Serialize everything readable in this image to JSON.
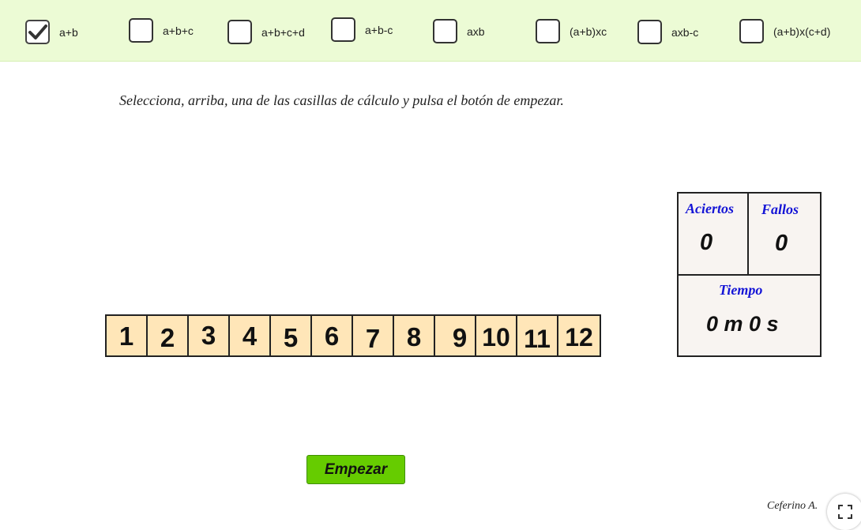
{
  "options": [
    {
      "label": "a+b",
      "checked": true
    },
    {
      "label": "a+b+c",
      "checked": false
    },
    {
      "label": "a+b+c+d",
      "checked": false
    },
    {
      "label": "a+b-c",
      "checked": false
    },
    {
      "label": "axb",
      "checked": false
    },
    {
      "label": "(a+b)xc",
      "checked": false
    },
    {
      "label": "axb-c",
      "checked": false
    },
    {
      "label": "(a+b)x(c+d)",
      "checked": false
    }
  ],
  "instruction": "Selecciona, arriba, una de las casillas de cálculo y pulsa el botón de empezar.",
  "score": {
    "aciertos_label": "Aciertos",
    "aciertos_value": "0",
    "fallos_label": "Fallos",
    "fallos_value": "0",
    "tiempo_label": "Tiempo",
    "tiempo_value": "0 m 0 s"
  },
  "numbers": [
    "1",
    "2",
    "3",
    "4",
    "5",
    "6",
    "7",
    "8",
    "9",
    "10",
    "11",
    "12"
  ],
  "start_button": "Empezar",
  "author": "Ceferino A.",
  "colors": {
    "topbar_bg": "#ecfbd5",
    "cell_bg": "#ffe6b8",
    "button_bg": "#66cc00",
    "score_label": "#1414d6",
    "score_bg": "#f8f4f1"
  },
  "icons": {
    "check": "checkmark-icon",
    "fullscreen": "fullscreen-icon"
  }
}
